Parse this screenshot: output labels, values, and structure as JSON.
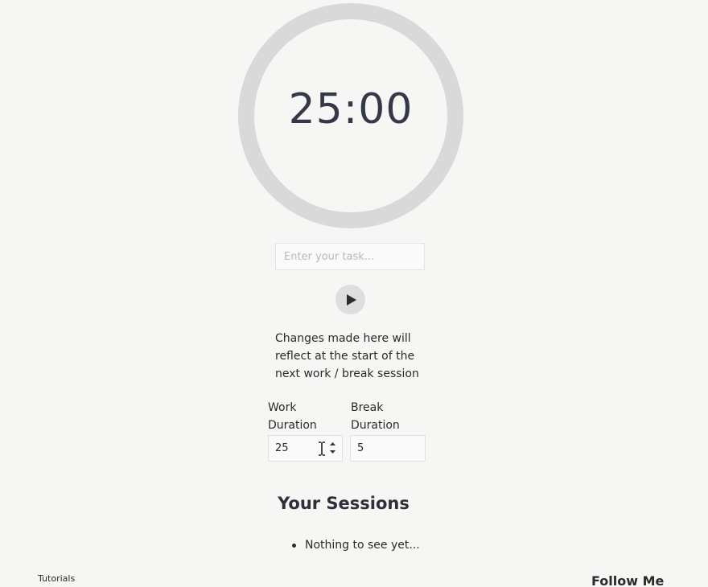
{
  "timer": {
    "display": "25:00"
  },
  "task": {
    "placeholder": "Enter your task..."
  },
  "controls": {
    "play_icon": "play-icon"
  },
  "settings": {
    "notice": "Changes made here will reflect at the start of the next work / break session",
    "work_label": "Work Duration",
    "work_value": "25",
    "break_label": "Break Duration",
    "break_value": "5"
  },
  "sessions": {
    "title": "Your Sessions",
    "items": [
      "Nothing to see yet..."
    ]
  },
  "footer": {
    "tutorials_label": "Tutorials",
    "follow_title": "Follow Me"
  },
  "colors": {
    "background": "#f6f6f4",
    "ring": "#d9d9d9",
    "timer_text": "#353848",
    "play_button": "#dedede"
  }
}
